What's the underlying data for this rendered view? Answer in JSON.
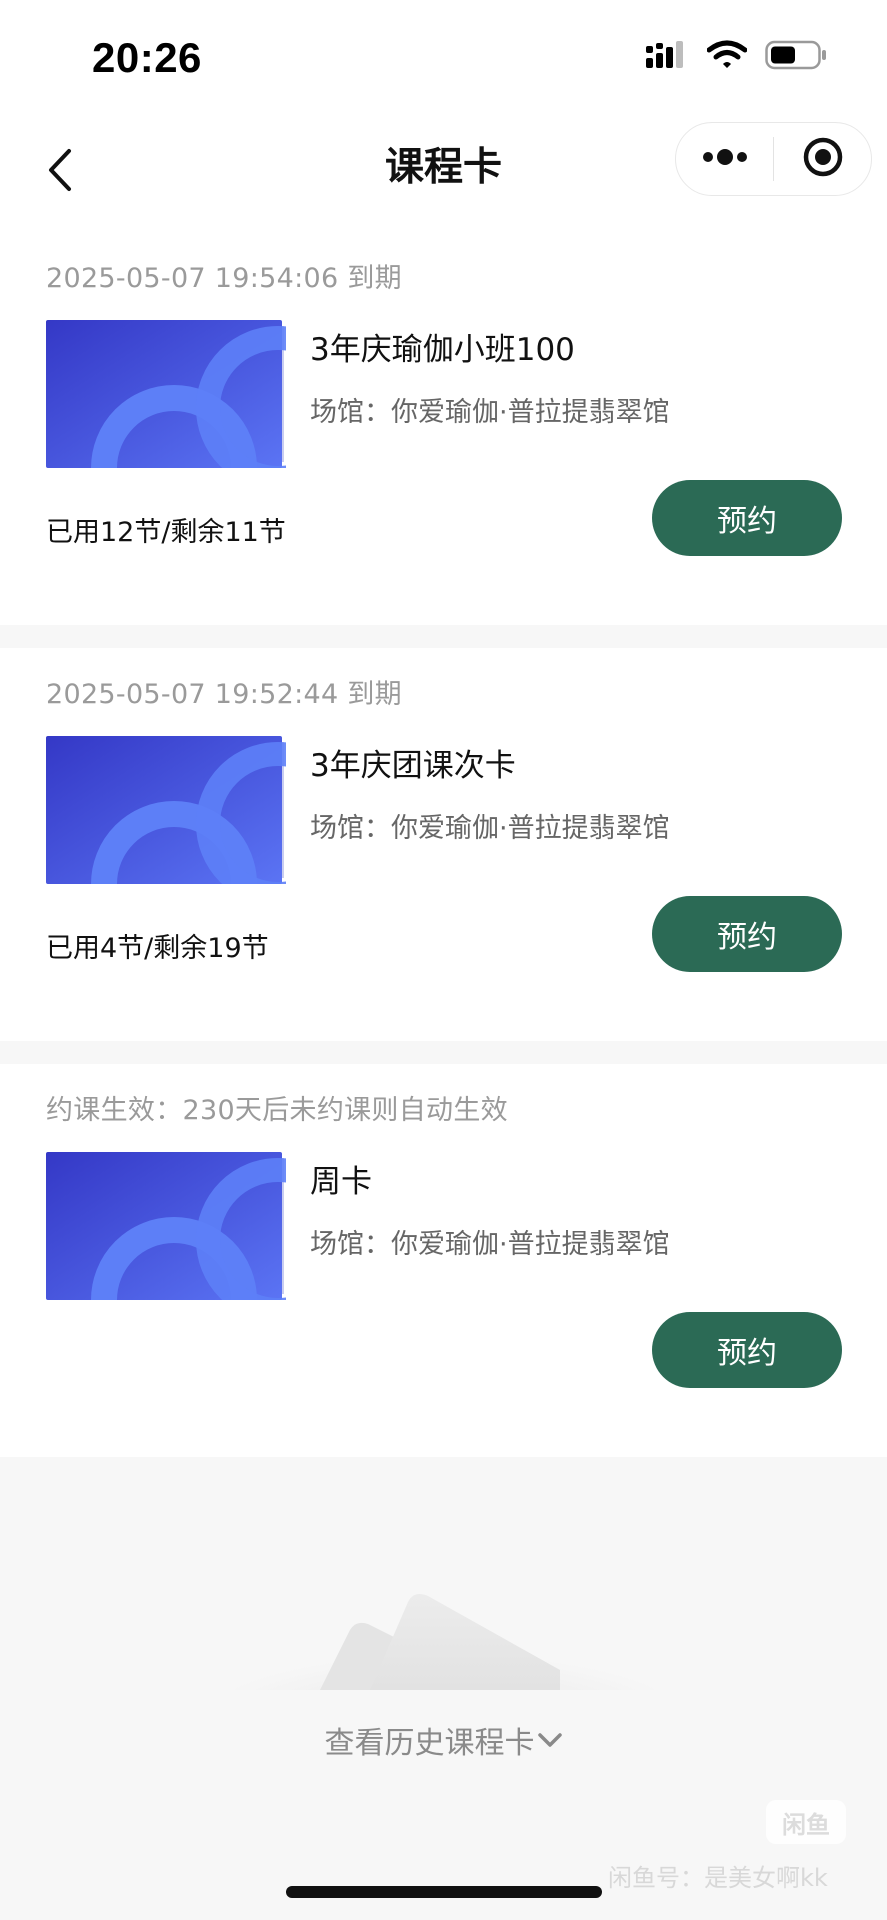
{
  "status_bar": {
    "time": "20:26",
    "icons": [
      "signal-icon",
      "wifi-icon",
      "battery-icon"
    ]
  },
  "nav": {
    "title": "课程卡",
    "back_icon": "chevron-left-icon",
    "menu_icon": "more-dots-icon",
    "close_icon": "target-circle-icon"
  },
  "cards": [
    {
      "header": "2025-05-07 19:54:06 到期",
      "name": "3年庆瑜伽小班100",
      "venue": "场馆：你爱瑜伽·普拉提翡翠馆",
      "usage": "已用12节/剩余11节",
      "button_label": "预约"
    },
    {
      "header": "2025-05-07 19:52:44 到期",
      "name": "3年庆团课次卡",
      "venue": "场馆：你爱瑜伽·普拉提翡翠馆",
      "usage": "已用4节/剩余19节",
      "button_label": "预约"
    },
    {
      "header": "约课生效：230天后未约课则自动生效",
      "name": "周卡",
      "venue": "场馆：你爱瑜伽·普拉提翡翠馆",
      "usage": "",
      "button_label": "预约"
    }
  ],
  "history_link": "查看历史课程卡",
  "watermark": {
    "logo": "闲鱼",
    "text": "闲鱼号：是美女啊kk"
  },
  "colors": {
    "accent": "#2b6a55",
    "thumb_start": "#3a3fcf",
    "thumb_end": "#5a73f2"
  }
}
